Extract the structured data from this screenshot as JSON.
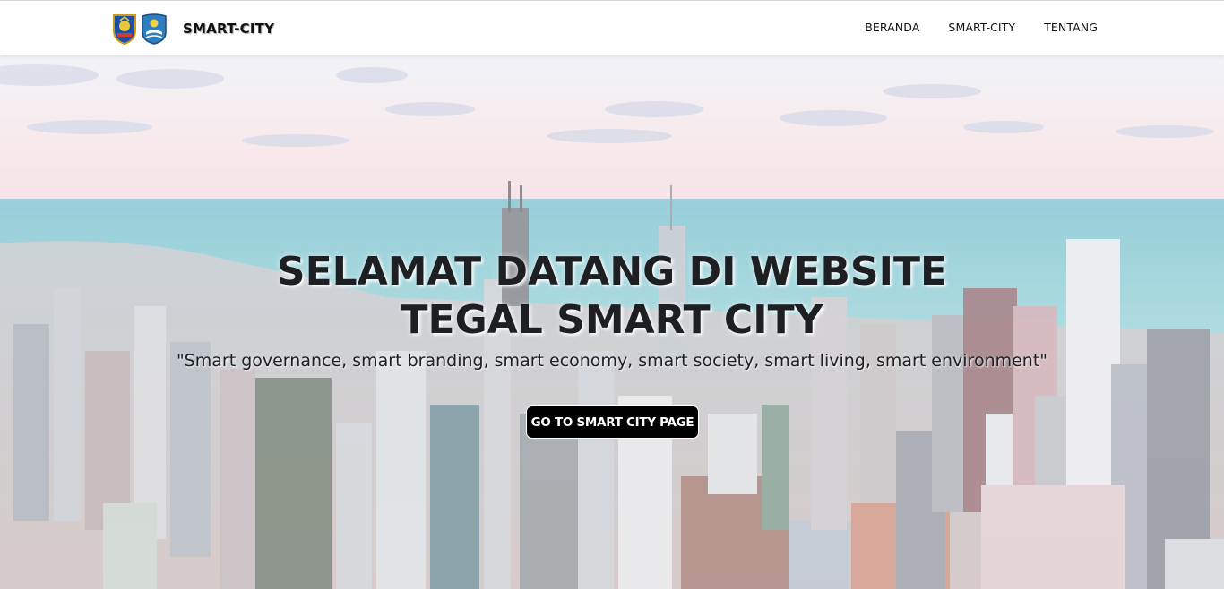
{
  "navbar": {
    "brand": "SMART-CITY",
    "logos": [
      "province-emblem-icon",
      "city-emblem-icon"
    ],
    "links": [
      "BERANDA",
      "SMART-CITY",
      "TENTANG"
    ]
  },
  "hero": {
    "title_line1": "SELAMAT DATANG DI WEBSITE",
    "title_line2": "TEGAL SMART CITY",
    "subtitle": "\"Smart governance, smart branding, smart economy, smart society, smart living, smart environment\"",
    "button": "GO TO SMART CITY PAGE",
    "background": "city-skyline-photo"
  },
  "colors": {
    "navbar_bg": "#ffffff",
    "text_dark": "#1d1f22",
    "button_bg": "#000000",
    "button_text": "#ffffff",
    "sky": "#f3dfe3",
    "sea": "#7fc6cf"
  }
}
